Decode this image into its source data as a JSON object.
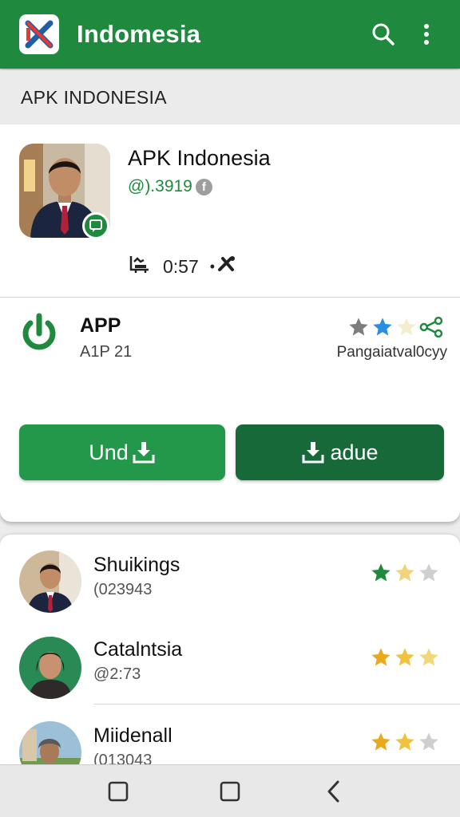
{
  "app_bar": {
    "title": "Indomesia",
    "logo_icon": "app-logo-icon",
    "search_icon": "search-icon",
    "menu_icon": "more-vert-icon",
    "color": "#1f8a3e"
  },
  "section_header": {
    "title": "APK INDONESIA"
  },
  "profile": {
    "name": "APK Indonesia",
    "handle": "@).3919",
    "handle_icon": "facebook-icon",
    "badge_icon": "chat-icon",
    "meta_icon_left": "chair-icon",
    "time": "0:57",
    "meta_prefix": "•",
    "meta_icon_right": "tools-icon"
  },
  "app_info": {
    "icon": "power-icon",
    "name": "APP",
    "subtitle": "A1P 21",
    "rating_icons": [
      "star-gray-icon",
      "star-blue-icon",
      "star-pale-icon",
      "share-icon"
    ],
    "rating_caption": "Pangaiatval0cyy"
  },
  "buttons": {
    "left_label": "Und",
    "left_icon": "download-icon",
    "right_label": "adue",
    "right_icon": "download-icon",
    "left_color": "#23984a",
    "right_color": "#17693a"
  },
  "list": [
    {
      "name": "Shuikings",
      "sub": "(023943",
      "avatar": "man-avatar",
      "star_colors": [
        "#1f8a3e",
        "#f3d27c",
        "#cfcfcf"
      ]
    },
    {
      "name": "Catalntsia",
      "sub": "@2:73",
      "avatar": "woman-avatar",
      "star_colors": [
        "#e9a91f",
        "#f0c23f",
        "#f1d87a"
      ]
    },
    {
      "name": "Miidenall",
      "sub": "(013043",
      "avatar": "man-avatar-outdoor",
      "star_colors": [
        "#e9a91f",
        "#f0c23f",
        "#cfcfcf"
      ]
    }
  ],
  "nav_bar": {
    "icons": [
      "recent-apps-icon",
      "home-icon",
      "back-icon"
    ]
  }
}
